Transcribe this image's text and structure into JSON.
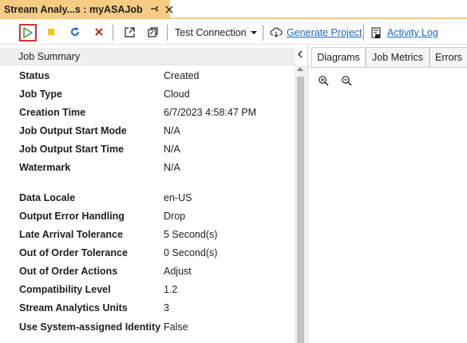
{
  "doc_tab": {
    "title": "Stream Analy...s : myASAJob",
    "pin_glyph": "⊕",
    "close_glyph": "✕"
  },
  "toolbar": {
    "test_connection_label": "Test Connection",
    "generate_project_label": "Generate Project",
    "activity_log_label": "Activity Log",
    "icons": [
      "play-icon",
      "stop-icon",
      "refresh-icon",
      "delete-icon",
      "open-external-icon",
      "copy-icon",
      "dropdown-arrow-icon",
      "cloud-download-icon",
      "log-icon"
    ],
    "colors": {
      "start_border": "#d13438",
      "play": "#3a9a4f",
      "stop": "#f2c811",
      "refresh": "#1a66c9",
      "delete": "#c42b1c",
      "link": "#1a66c9"
    }
  },
  "summary": {
    "header": "Job Summary",
    "rows": [
      {
        "key": "Status",
        "value": "Created"
      },
      {
        "key": "Job Type",
        "value": "Cloud"
      },
      {
        "key": "Creation Time",
        "value": "6/7/2023 4:58:47 PM"
      },
      {
        "key": "Job Output Start Mode",
        "value": "N/A"
      },
      {
        "key": "Job Output Start Time",
        "value": "N/A"
      },
      {
        "key": "Watermark",
        "value": "N/A"
      },
      {
        "key": "Data Locale",
        "value": "en-US"
      },
      {
        "key": "Output Error Handling",
        "value": "Drop"
      },
      {
        "key": "Late Arrival Tolerance",
        "value": "5 Second(s)"
      },
      {
        "key": "Out of Order Tolerance",
        "value": "0 Second(s)"
      },
      {
        "key": "Out of Order Actions",
        "value": "Adjust"
      },
      {
        "key": "Compatibility Level",
        "value": "1.2"
      },
      {
        "key": "Stream Analytics Units",
        "value": "3"
      },
      {
        "key": "Use System-assigned Identity",
        "value": "False"
      }
    ]
  },
  "right_panel": {
    "tabs": [
      "Diagrams",
      "Job Metrics",
      "Errors"
    ],
    "active_tab": "Diagrams"
  }
}
